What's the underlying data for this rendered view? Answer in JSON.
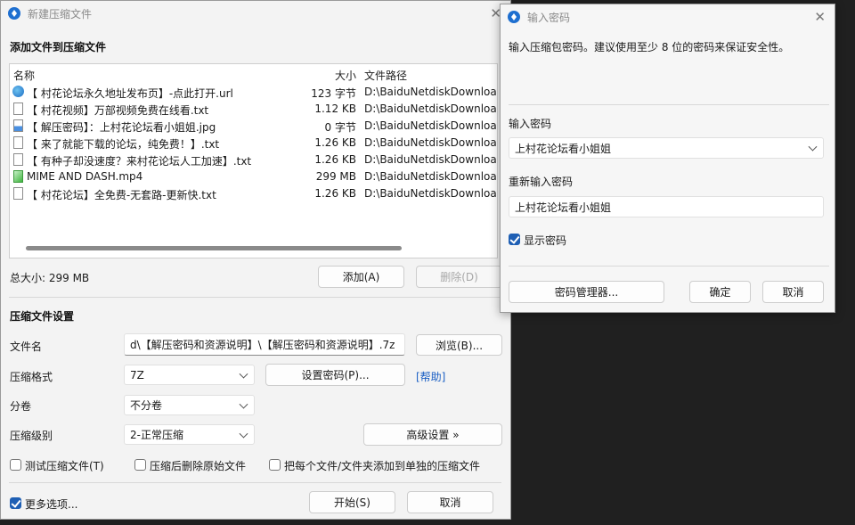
{
  "main": {
    "title": "新建压缩文件",
    "section_add": "添加文件到压缩文件",
    "columns": {
      "name": "名称",
      "size": "大小",
      "path": "文件路径"
    },
    "files": [
      {
        "icon": "web",
        "name": "【 村花论坛永久地址发布页】-点此打开.url",
        "size": "123 字节",
        "path": "D:\\BaiduNetdiskDownload"
      },
      {
        "icon": "txt",
        "name": "【 村花视频】万部视频免费在线看.txt",
        "size": "1.12 KB",
        "path": "D:\\BaiduNetdiskDownload"
      },
      {
        "icon": "img",
        "name": "【 解压密码】：上村花论坛看小姐姐.jpg",
        "size": "0 字节",
        "path": "D:\\BaiduNetdiskDownload"
      },
      {
        "icon": "txt",
        "name": "【 来了就能下载的论坛，纯免费！】.txt",
        "size": "1.26 KB",
        "path": "D:\\BaiduNetdiskDownload"
      },
      {
        "icon": "txt",
        "name": "【 有种子却没速度？来村花论坛人工加速】.txt",
        "size": "1.26 KB",
        "path": "D:\\BaiduNetdiskDownload"
      },
      {
        "icon": "vid",
        "name": "MIME AND DASH.mp4",
        "size": "299 MB",
        "path": "D:\\BaiduNetdiskDownload"
      },
      {
        "icon": "txt",
        "name": "【 村花论坛】全免费-无套路-更新快.txt",
        "size": "1.26 KB",
        "path": "D:\\BaiduNetdiskDownload"
      }
    ],
    "total_size": "总大小: 299 MB",
    "add_button": "添加(A)",
    "delete_button": "删除(D)",
    "section_settings": "压缩文件设置",
    "filename_label": "文件名",
    "filename_value": "d\\【解压密码和资源说明】\\【解压密码和资源说明】.7z",
    "browse_button": "浏览(B)...",
    "format_label": "压缩格式",
    "format_value": "7Z",
    "set_password_button": "设置密码(P)...",
    "help_link": "[帮助]",
    "split_label": "分卷",
    "split_value": "不分卷",
    "level_label": "压缩级别",
    "level_value": "2-正常压缩",
    "advanced_button": "高级设置 »",
    "opt_test": "测试压缩文件(T)",
    "opt_delete": "压缩后删除原始文件",
    "opt_separate": "把每个文件/文件夹添加到单独的压缩文件",
    "more_options": "更多选项...",
    "start_button": "开始(S)",
    "cancel_button": "取消"
  },
  "dialog": {
    "title": "输入密码",
    "description": "输入压缩包密码。建议使用至少 8 位的密码来保证安全性。",
    "password_label": "输入密码",
    "password_value": "上村花论坛看小姐姐",
    "confirm_label": "重新输入密码",
    "confirm_value": "上村花论坛看小姐姐",
    "show_password": "显示密码",
    "manager_button": "密码管理器...",
    "ok_button": "确定",
    "cancel_button": "取消"
  },
  "colors": {
    "accent": "#1e5fb4",
    "link": "#1a5fc4",
    "background": "#202020",
    "window": "#f3f3f3"
  }
}
